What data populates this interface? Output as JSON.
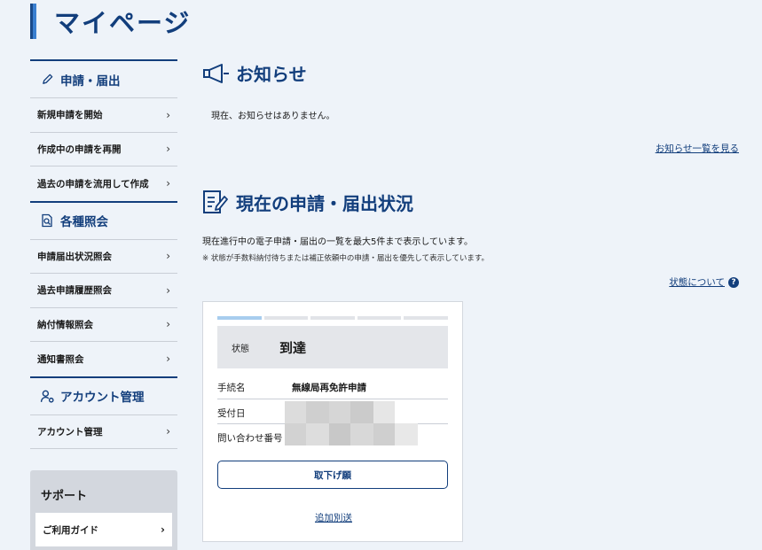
{
  "header": {
    "title": "マイページ"
  },
  "sidebar": {
    "sections": [
      {
        "title": "申請・届出",
        "icon": "pencil-icon",
        "items": [
          "新規申請を開始",
          "作成中の申請を再開",
          "過去の申請を流用して作成"
        ]
      },
      {
        "title": "各種照会",
        "icon": "document-search-icon",
        "items": [
          "申請届出状況照会",
          "過去申請履歴照会",
          "納付情報照会",
          "通知書照会"
        ]
      },
      {
        "title": "アカウント管理",
        "icon": "user-settings-icon",
        "items": [
          "アカウント管理"
        ]
      }
    ],
    "support": {
      "title": "サポート",
      "items": [
        "ご利用ガイド"
      ]
    }
  },
  "notice": {
    "title": "お知らせ",
    "icon": "megaphone-icon",
    "message": "現在、お知らせはありません。",
    "list_link": "お知らせ一覧を見る"
  },
  "status": {
    "title": "現在の申請・届出状況",
    "icon": "form-edit-icon",
    "description": "現在進行中の電子申請・届出の一覧を最大5件まで表示しています。",
    "note": "※ 状態が手数料納付待ちまたは補正依頼中の申請・届出を優先して表示しています。",
    "about_link": "状態について",
    "help_icon": "question-circle-icon",
    "card": {
      "progress_steps": 5,
      "progress_current": 1,
      "state_label": "状態",
      "state_value": "到達",
      "rows": [
        {
          "label": "手続名",
          "value": "無線局再免許申請"
        },
        {
          "label": "受付日",
          "value": ""
        },
        {
          "label": "問い合わせ番号",
          "value": ""
        }
      ],
      "withdraw_button": "取下げ願",
      "additional_link": "追加別送"
    }
  },
  "colors": {
    "primary": "#123e7c",
    "background": "#eef3f9",
    "progress_active": "#a8cdee"
  }
}
